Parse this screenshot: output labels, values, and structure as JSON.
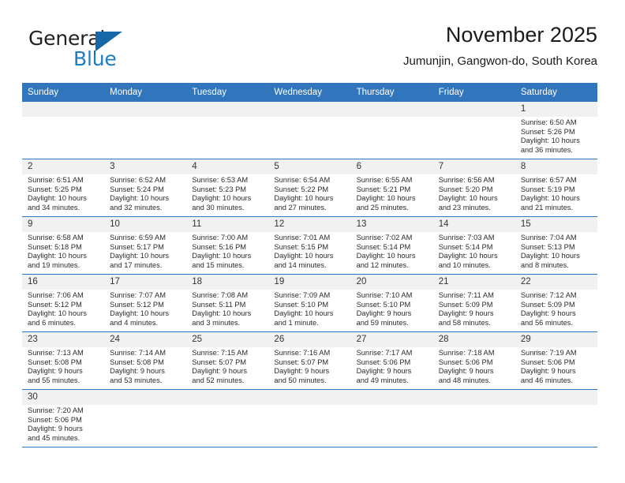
{
  "brand": {
    "name_top": "General",
    "name_bottom": "Blue",
    "accent_color": "#1767a8",
    "text_color": "#231f20"
  },
  "header": {
    "title": "November 2025",
    "subtitle": "Jumunjin, Gangwon-do, South Korea"
  },
  "theme": {
    "header_band": "#3176bc",
    "day_strip": "#f1f1f1",
    "row_divider": "#3176bc"
  },
  "weekdays": [
    "Sunday",
    "Monday",
    "Tuesday",
    "Wednesday",
    "Thursday",
    "Friday",
    "Saturday"
  ],
  "weeks": [
    [
      {
        "day": "",
        "lines": []
      },
      {
        "day": "",
        "lines": []
      },
      {
        "day": "",
        "lines": []
      },
      {
        "day": "",
        "lines": []
      },
      {
        "day": "",
        "lines": []
      },
      {
        "day": "",
        "lines": []
      },
      {
        "day": "1",
        "lines": [
          "Sunrise: 6:50 AM",
          "Sunset: 5:26 PM",
          "Daylight: 10 hours",
          "and 36 minutes."
        ]
      }
    ],
    [
      {
        "day": "2",
        "lines": [
          "Sunrise: 6:51 AM",
          "Sunset: 5:25 PM",
          "Daylight: 10 hours",
          "and 34 minutes."
        ]
      },
      {
        "day": "3",
        "lines": [
          "Sunrise: 6:52 AM",
          "Sunset: 5:24 PM",
          "Daylight: 10 hours",
          "and 32 minutes."
        ]
      },
      {
        "day": "4",
        "lines": [
          "Sunrise: 6:53 AM",
          "Sunset: 5:23 PM",
          "Daylight: 10 hours",
          "and 30 minutes."
        ]
      },
      {
        "day": "5",
        "lines": [
          "Sunrise: 6:54 AM",
          "Sunset: 5:22 PM",
          "Daylight: 10 hours",
          "and 27 minutes."
        ]
      },
      {
        "day": "6",
        "lines": [
          "Sunrise: 6:55 AM",
          "Sunset: 5:21 PM",
          "Daylight: 10 hours",
          "and 25 minutes."
        ]
      },
      {
        "day": "7",
        "lines": [
          "Sunrise: 6:56 AM",
          "Sunset: 5:20 PM",
          "Daylight: 10 hours",
          "and 23 minutes."
        ]
      },
      {
        "day": "8",
        "lines": [
          "Sunrise: 6:57 AM",
          "Sunset: 5:19 PM",
          "Daylight: 10 hours",
          "and 21 minutes."
        ]
      }
    ],
    [
      {
        "day": "9",
        "lines": [
          "Sunrise: 6:58 AM",
          "Sunset: 5:18 PM",
          "Daylight: 10 hours",
          "and 19 minutes."
        ]
      },
      {
        "day": "10",
        "lines": [
          "Sunrise: 6:59 AM",
          "Sunset: 5:17 PM",
          "Daylight: 10 hours",
          "and 17 minutes."
        ]
      },
      {
        "day": "11",
        "lines": [
          "Sunrise: 7:00 AM",
          "Sunset: 5:16 PM",
          "Daylight: 10 hours",
          "and 15 minutes."
        ]
      },
      {
        "day": "12",
        "lines": [
          "Sunrise: 7:01 AM",
          "Sunset: 5:15 PM",
          "Daylight: 10 hours",
          "and 14 minutes."
        ]
      },
      {
        "day": "13",
        "lines": [
          "Sunrise: 7:02 AM",
          "Sunset: 5:14 PM",
          "Daylight: 10 hours",
          "and 12 minutes."
        ]
      },
      {
        "day": "14",
        "lines": [
          "Sunrise: 7:03 AM",
          "Sunset: 5:14 PM",
          "Daylight: 10 hours",
          "and 10 minutes."
        ]
      },
      {
        "day": "15",
        "lines": [
          "Sunrise: 7:04 AM",
          "Sunset: 5:13 PM",
          "Daylight: 10 hours",
          "and 8 minutes."
        ]
      }
    ],
    [
      {
        "day": "16",
        "lines": [
          "Sunrise: 7:06 AM",
          "Sunset: 5:12 PM",
          "Daylight: 10 hours",
          "and 6 minutes."
        ]
      },
      {
        "day": "17",
        "lines": [
          "Sunrise: 7:07 AM",
          "Sunset: 5:12 PM",
          "Daylight: 10 hours",
          "and 4 minutes."
        ]
      },
      {
        "day": "18",
        "lines": [
          "Sunrise: 7:08 AM",
          "Sunset: 5:11 PM",
          "Daylight: 10 hours",
          "and 3 minutes."
        ]
      },
      {
        "day": "19",
        "lines": [
          "Sunrise: 7:09 AM",
          "Sunset: 5:10 PM",
          "Daylight: 10 hours",
          "and 1 minute."
        ]
      },
      {
        "day": "20",
        "lines": [
          "Sunrise: 7:10 AM",
          "Sunset: 5:10 PM",
          "Daylight: 9 hours",
          "and 59 minutes."
        ]
      },
      {
        "day": "21",
        "lines": [
          "Sunrise: 7:11 AM",
          "Sunset: 5:09 PM",
          "Daylight: 9 hours",
          "and 58 minutes."
        ]
      },
      {
        "day": "22",
        "lines": [
          "Sunrise: 7:12 AM",
          "Sunset: 5:09 PM",
          "Daylight: 9 hours",
          "and 56 minutes."
        ]
      }
    ],
    [
      {
        "day": "23",
        "lines": [
          "Sunrise: 7:13 AM",
          "Sunset: 5:08 PM",
          "Daylight: 9 hours",
          "and 55 minutes."
        ]
      },
      {
        "day": "24",
        "lines": [
          "Sunrise: 7:14 AM",
          "Sunset: 5:08 PM",
          "Daylight: 9 hours",
          "and 53 minutes."
        ]
      },
      {
        "day": "25",
        "lines": [
          "Sunrise: 7:15 AM",
          "Sunset: 5:07 PM",
          "Daylight: 9 hours",
          "and 52 minutes."
        ]
      },
      {
        "day": "26",
        "lines": [
          "Sunrise: 7:16 AM",
          "Sunset: 5:07 PM",
          "Daylight: 9 hours",
          "and 50 minutes."
        ]
      },
      {
        "day": "27",
        "lines": [
          "Sunrise: 7:17 AM",
          "Sunset: 5:06 PM",
          "Daylight: 9 hours",
          "and 49 minutes."
        ]
      },
      {
        "day": "28",
        "lines": [
          "Sunrise: 7:18 AM",
          "Sunset: 5:06 PM",
          "Daylight: 9 hours",
          "and 48 minutes."
        ]
      },
      {
        "day": "29",
        "lines": [
          "Sunrise: 7:19 AM",
          "Sunset: 5:06 PM",
          "Daylight: 9 hours",
          "and 46 minutes."
        ]
      }
    ],
    [
      {
        "day": "30",
        "lines": [
          "Sunrise: 7:20 AM",
          "Sunset: 5:06 PM",
          "Daylight: 9 hours",
          "and 45 minutes."
        ]
      },
      {
        "day": "",
        "lines": []
      },
      {
        "day": "",
        "lines": []
      },
      {
        "day": "",
        "lines": []
      },
      {
        "day": "",
        "lines": []
      },
      {
        "day": "",
        "lines": []
      },
      {
        "day": "",
        "lines": []
      }
    ]
  ]
}
